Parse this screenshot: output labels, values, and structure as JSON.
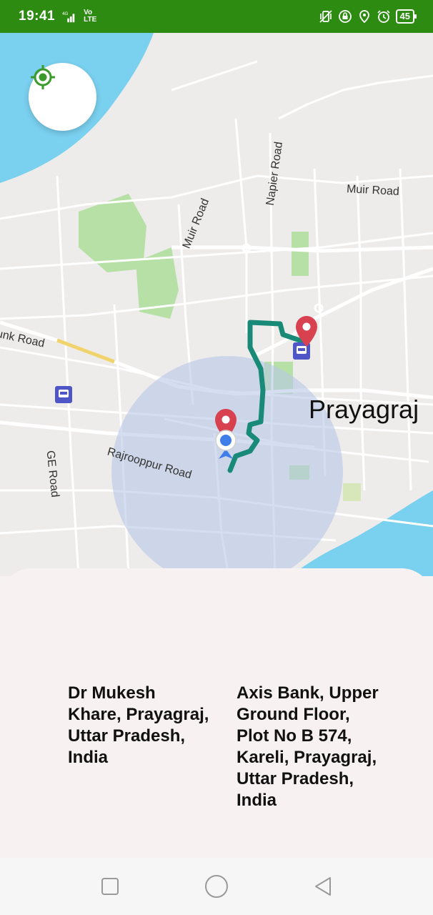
{
  "status_bar": {
    "time": "19:41",
    "network": "4G",
    "volte": "Vo LTE",
    "battery": "45",
    "icons": [
      "signal-icon",
      "vibrate-icon",
      "lock-icon",
      "location-icon",
      "alarm-icon",
      "battery-icon"
    ]
  },
  "map": {
    "locate_icon": "my-location-icon",
    "city": "Prayagraj",
    "roads": [
      "Muir Road",
      "Napier Road",
      "Muir Road",
      "Trunk Road",
      "GE Road",
      "Rajrooppur Road"
    ],
    "colors": {
      "route": "#1a8a78",
      "pin": "#d8414f",
      "water": "#7ad0ef",
      "park": "#b6e0a6",
      "radius": "#b7c8e6"
    }
  },
  "directions": {
    "origin": "Dr Mukesh Khare, Prayagraj, Uttar Pradesh, India",
    "destination": "Axis Bank, Upper Ground Floor, Plot No B 574, Kareli, Prayagraj, Uttar Pradesh, India"
  },
  "nav_bar": {
    "icons": [
      "recent-apps-icon",
      "home-icon",
      "back-icon"
    ]
  }
}
